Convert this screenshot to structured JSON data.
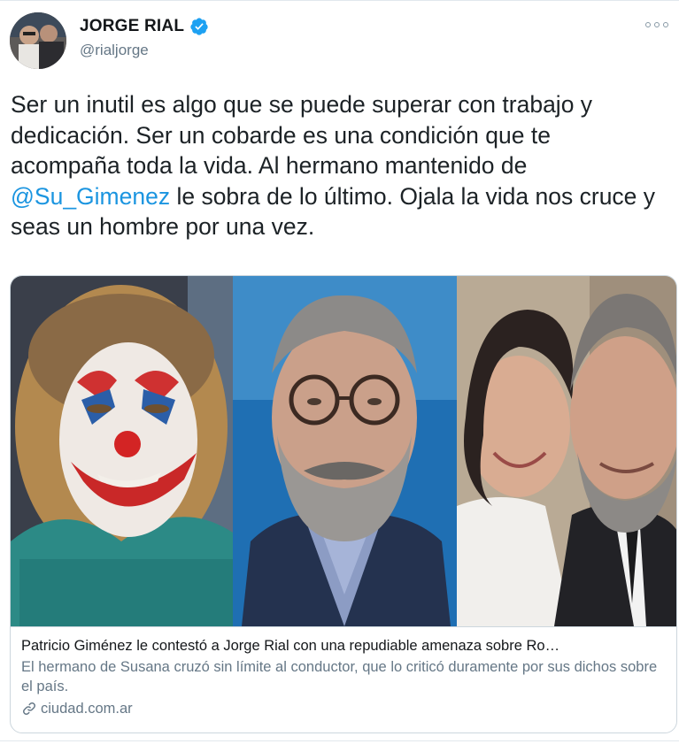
{
  "author": {
    "display_name": "JORGE RIAL",
    "handle": "@rialjorge",
    "verified": true
  },
  "tweet": {
    "text_before_mention": "Ser un inutil es algo que se puede superar con trabajo y dedicación. Ser un cobarde es una condición que te acompaña toda la vida. Al hermano mantenido de ",
    "mention": "@Su_Gimenez",
    "text_after_mention": " le sobra de lo último. Ojala la vida nos cruce y seas un hombre por una vez."
  },
  "card": {
    "title": "Patricio Giménez le contestó a Jorge Rial con una repudiable amenaza sobre Ro…",
    "description": "El hermano de Susana cruzó sin límite al conductor, que lo criticó duramente por sus dichos sobre el país.",
    "domain": "ciudad.com.ar",
    "images": [
      "clown-face-photo",
      "man-with-glasses-photo",
      "couple-photo"
    ]
  },
  "icons": {
    "verified": "verified-badge-icon",
    "more": "more-options-icon",
    "link": "link-icon"
  },
  "colors": {
    "link_blue": "#1b95e0",
    "verified_blue": "#1da1f2",
    "secondary_text": "#657786"
  }
}
